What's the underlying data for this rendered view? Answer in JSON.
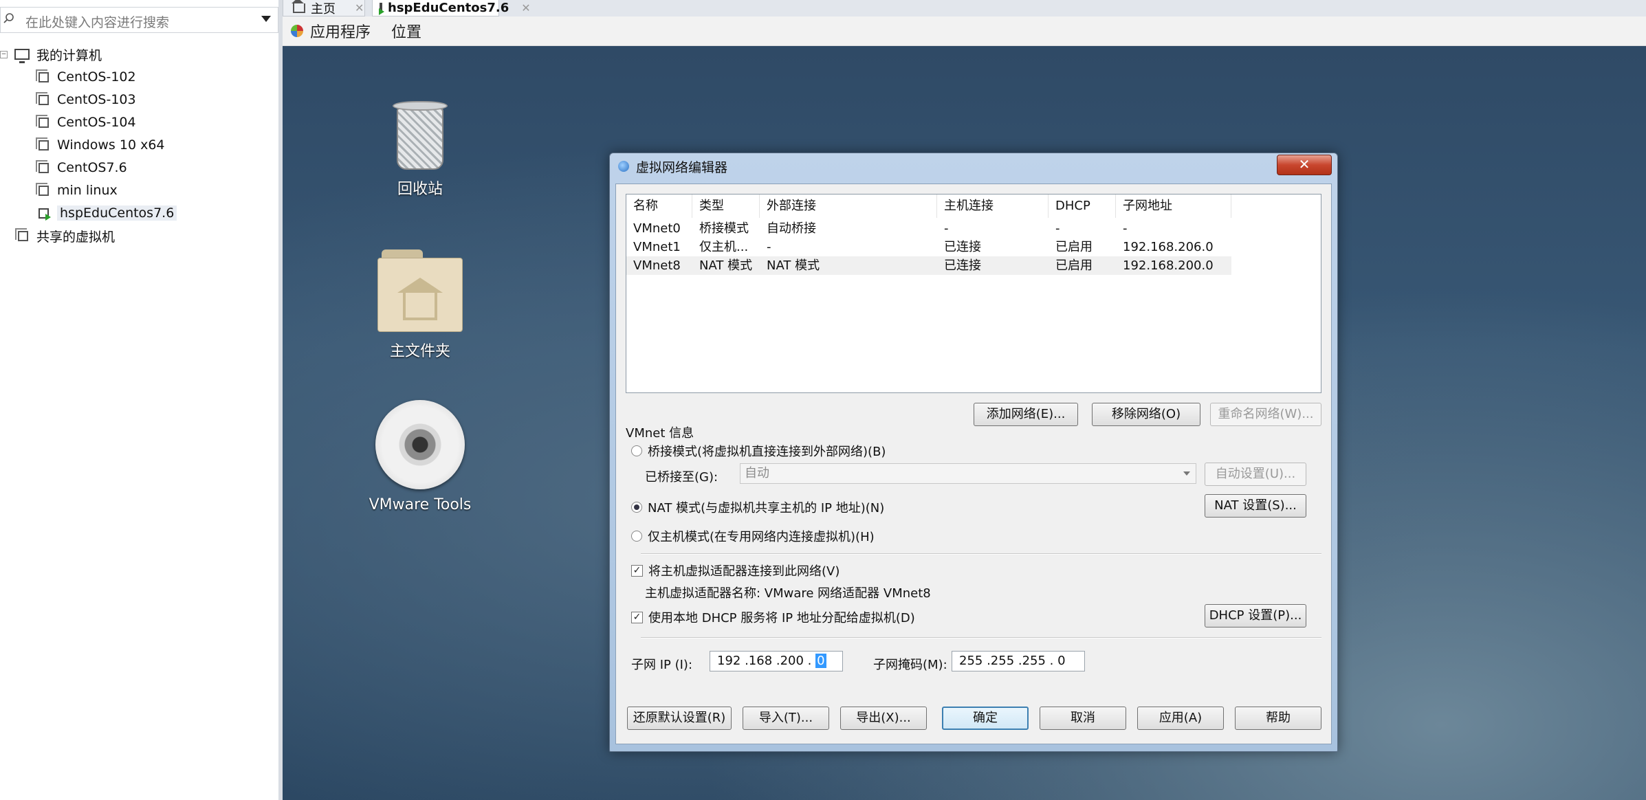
{
  "sidebar": {
    "search_placeholder": "在此处键入内容进行搜索",
    "root_label": "我的计算机",
    "vms": [
      "CentOS-102",
      "CentOS-103",
      "CentOS-104",
      "Windows 10 x64",
      "CentOS7.6",
      "min linux",
      "hspEduCentos7.6"
    ],
    "shared_label": "共享的虚拟机"
  },
  "tabs": {
    "home": "主页",
    "vm": "hspEduCentos7.6"
  },
  "guest_panel": {
    "apps": "应用程序",
    "places": "位置"
  },
  "desktop": {
    "trash": "回收站",
    "home_folder": "主文件夹",
    "vmware_tools": "VMware Tools"
  },
  "dialog": {
    "title": "虚拟网络编辑器",
    "close": "✕",
    "columns": [
      "名称",
      "类型",
      "外部连接",
      "主机连接",
      "DHCP",
      "子网地址"
    ],
    "rows": [
      [
        "VMnet0",
        "桥接模式",
        "自动桥接",
        "-",
        "-",
        "-"
      ],
      [
        "VMnet1",
        "仅主机...",
        "-",
        "已连接",
        "已启用",
        "192.168.206.0"
      ],
      [
        "VMnet8",
        "NAT 模式",
        "NAT 模式",
        "已连接",
        "已启用",
        "192.168.200.0"
      ]
    ],
    "add_network": "添加网络(E)...",
    "remove_network": "移除网络(O)",
    "rename_network": "重命名网络(W)...",
    "vmnet_info": "VMnet 信息",
    "bridge_mode": "桥接模式(将虚拟机直接连接到外部网络)(B)",
    "bridged_to": "已桥接至(G):",
    "bridged_to_value": "自动",
    "auto_settings": "自动设置(U)...",
    "nat_mode": "NAT 模式(与虚拟机共享主机的 IP 地址)(N)",
    "nat_settings": "NAT 设置(S)...",
    "host_only": "仅主机模式(在专用网络内连接虚拟机)(H)",
    "connect_adapter": "将主机虚拟适配器连接到此网络(V)",
    "adapter_name": "主机虚拟适配器名称: VMware 网络适配器 VMnet8",
    "use_dhcp": "使用本地 DHCP 服务将 IP 地址分配给虚拟机(D)",
    "dhcp_settings": "DHCP 设置(P)...",
    "subnet_ip_label": "子网 IP (I):",
    "subnet_ip_prefix": "192 .168 .200 .",
    "subnet_ip_last": "0",
    "subnet_mask_label": "子网掩码(M):",
    "subnet_mask": "255 .255 .255 . 0",
    "restore_defaults": "还原默认设置(R)",
    "import": "导入(T)...",
    "export": "导出(X)...",
    "ok": "确定",
    "cancel": "取消",
    "apply": "应用(A)",
    "help": "帮助"
  },
  "colors": {
    "dialog_frame": "#a8c2de",
    "close_button": "#c8462e",
    "desktop": "#385774"
  }
}
